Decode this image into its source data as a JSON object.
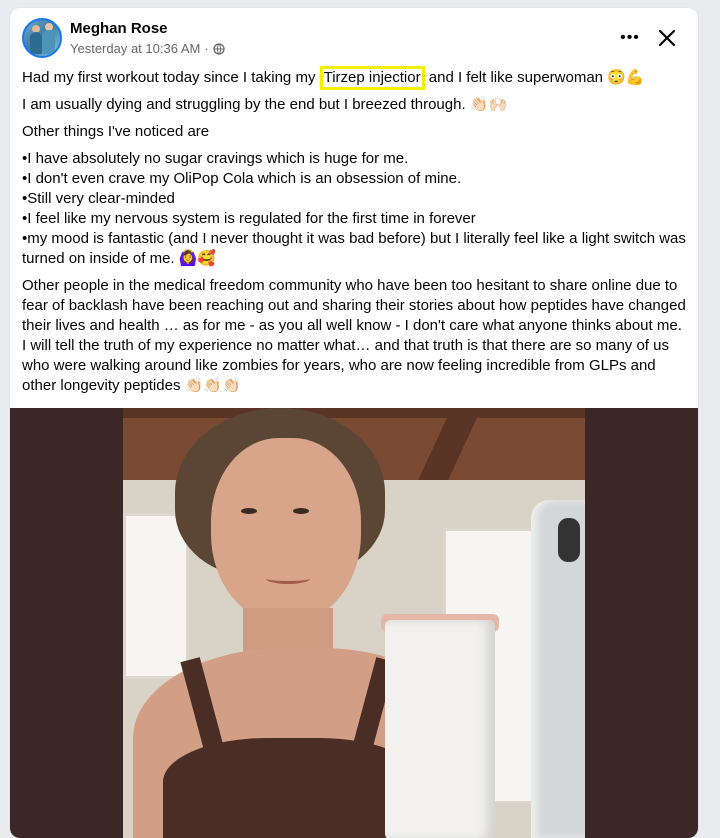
{
  "post": {
    "author": "Meghan Rose",
    "timestamp": "Yesterday at 10:36 AM",
    "separator": "·",
    "audience_icon": "globe-icon",
    "more_label": "•••",
    "close_icon": "close-icon",
    "line1_before": "Had my first workout today since I taking my ",
    "line1_highlight": "Tirzep injectior",
    "line1_after": " and I felt like superwoman 😳💪",
    "line2": "I am usually dying and struggling by the end but I breezed through. 👏🏻🙌🏻",
    "line3": "Other things I've noticed are",
    "bullets": [
      "•I have absolutely no sugar cravings which is huge for me.",
      "•I don't even crave my OliPop Cola which is an obsession of mine.",
      "•Still very clear-minded",
      "•I feel like my nervous system is regulated for the first time in forever",
      "•my mood is fantastic (and I never thought it was bad before) but I literally feel like a light switch was turned on inside of me. 🙆‍♀️🥰"
    ],
    "paragraph": "Other people in the medical freedom community who have been too hesitant to share online due to fear of backlash have been reaching out and sharing their stories about how peptides have changed their lives and health … as for me - as you all well know - I don't care what anyone thinks about me. I will tell the truth of my experience no matter what… and that truth is that there are so many of us who were walking around like zombies for years, who are now feeling incredible from GLPs and other longevity peptides 👏🏻👏🏻👏🏻",
    "highlight_color": "#f2ef00"
  }
}
